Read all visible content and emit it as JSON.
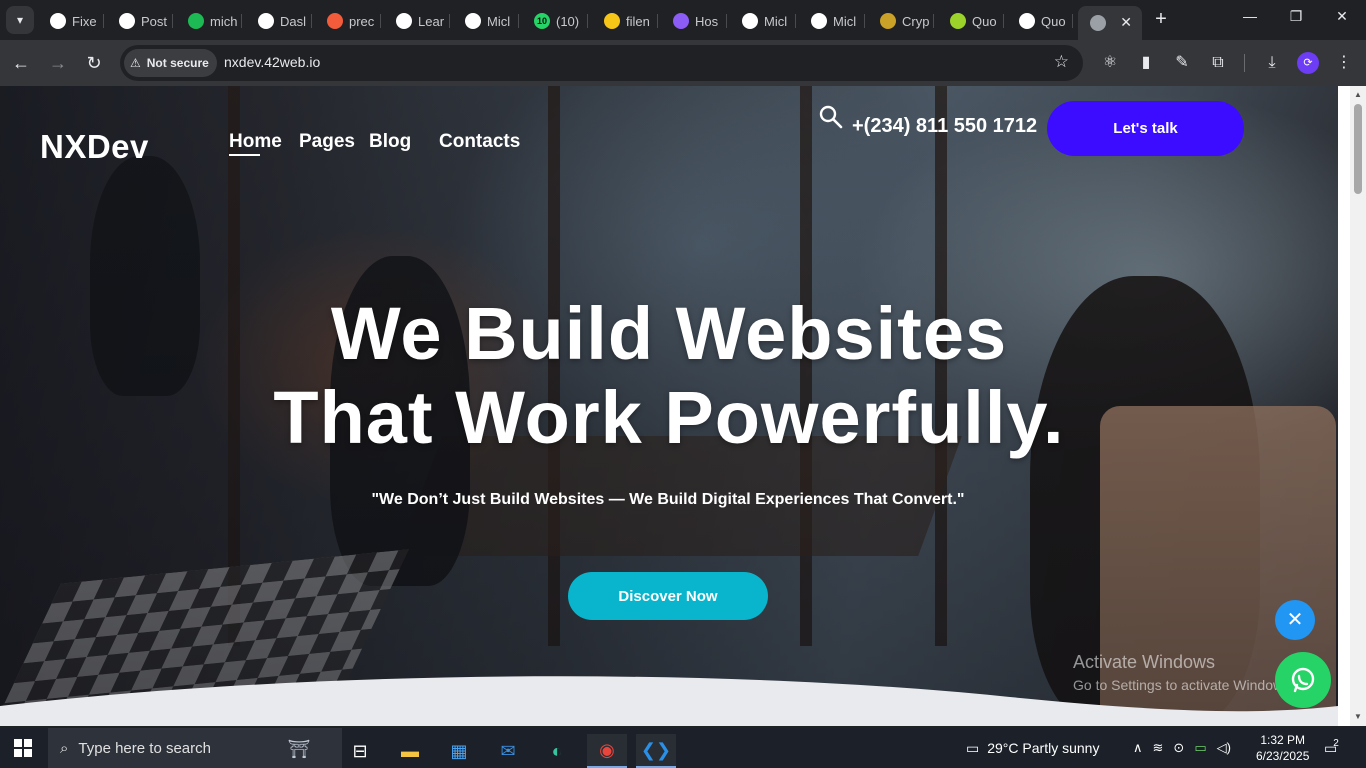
{
  "browser": {
    "tabs": [
      {
        "label": "Fixe",
        "icon": "github-icon",
        "color": "#ffffff"
      },
      {
        "label": "Post",
        "icon": "openai-icon",
        "color": "#ffffff"
      },
      {
        "label": "mich",
        "icon": "bolt-icon",
        "color": "#1db954"
      },
      {
        "label": "Dasl",
        "icon": "dashboard-icon",
        "color": "#ffffff"
      },
      {
        "label": "prec",
        "icon": "precision-icon",
        "color": "#f25c3b"
      },
      {
        "label": "Lear",
        "icon": "openai-icon",
        "color": "#ffffff"
      },
      {
        "label": "Micl",
        "icon": "globe-icon",
        "color": "#ffffff"
      },
      {
        "label": "(10)",
        "icon": "whatsapp-icon",
        "color": "#25d366",
        "badge": "10"
      },
      {
        "label": "filen",
        "icon": "filen-icon",
        "color": "#f5c518"
      },
      {
        "label": "Hos",
        "icon": "infinity-icon",
        "color": "#8b5cf6"
      },
      {
        "label": "Micl",
        "icon": "globe-icon",
        "color": "#ffffff"
      },
      {
        "label": "Micl",
        "icon": "github-icon",
        "color": "#ffffff"
      },
      {
        "label": "Cryp",
        "icon": "crypto-icon",
        "color": "#c9a227"
      },
      {
        "label": "Quo",
        "icon": "quote-icon",
        "color": "#9bd32b"
      },
      {
        "label": "Quo",
        "icon": "globe-icon",
        "color": "#ffffff"
      }
    ],
    "active_tab_icon": "globe-icon",
    "security_label": "Not secure",
    "url": "nxdev.42web.io"
  },
  "site": {
    "logo": "NXDev",
    "nav": [
      "Home",
      "Pages",
      "Blog",
      "Contacts"
    ],
    "phone": "+(234) 811 550 1712",
    "cta": "Let's talk",
    "headline_1": "We Build Websites",
    "headline_2": "That Work Powerfully.",
    "tagline": "\"We Don’t Just Build Websites — We Build Digital Experiences That Convert.\"",
    "discover": "Discover Now",
    "colors": {
      "cta": "#3b0cff",
      "discover": "#08b5cc",
      "whatsapp": "#25d366",
      "close": "#2196f3"
    }
  },
  "watermark": {
    "line1": "Activate Windows",
    "line2": "Go to Settings to activate Windows."
  },
  "taskbar": {
    "search_placeholder": "Type here to search",
    "weather": "29°C  Partly sunny",
    "time": "1:32 PM",
    "date": "6/23/2025",
    "notification_count": "2"
  }
}
